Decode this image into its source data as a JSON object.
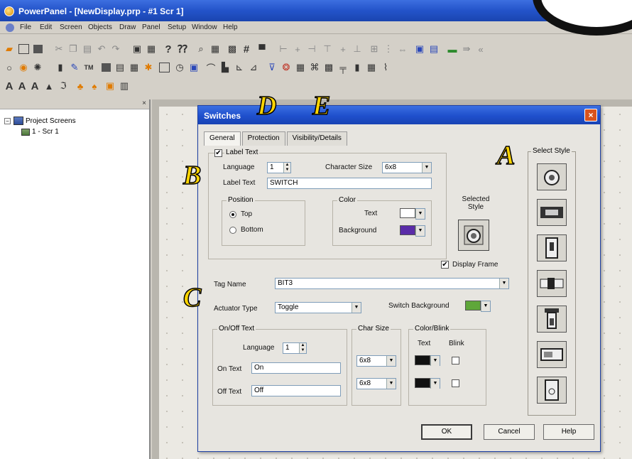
{
  "window": {
    "title": "PowerPanel - [NewDisplay.prp - #1 Scr 1]",
    "menu": [
      "File",
      "Edit",
      "Screen",
      "Objects",
      "Draw",
      "Panel",
      "Setup",
      "Window",
      "Help"
    ]
  },
  "toolbars": {
    "row1": [
      "open-icon",
      "new-icon",
      "save-icon",
      "cut-icon",
      "copy-icon",
      "paste-icon",
      "undo-icon",
      "redo-icon",
      "preview-icon",
      "print-icon",
      "help-icon",
      "context-help-icon",
      "zoom-icon",
      "grid-icon",
      "align-grid-icon",
      "hash-grid-icon",
      "snap-icon",
      "align-left-icon",
      "align-center-icon",
      "align-right-icon",
      "align-top-icon",
      "align-middle-icon",
      "align-bottom-icon",
      "distribute-h-icon",
      "distribute-v-icon",
      "size-icon",
      "color-icon",
      "layer-icon",
      "tag-icon",
      "more-icon",
      "scroll-icon"
    ],
    "row2": [
      "circle-icon",
      "filled-circle-icon",
      "star-icon",
      "meter-icon",
      "pen-icon",
      "tm-icon",
      "screen-icon",
      "list-icon",
      "table-icon",
      "lamp-icon",
      "box-icon",
      "clock-icon",
      "monitor-icon",
      "trend-icon",
      "bar-chart-icon",
      "gauge-icon",
      "alarm-icon",
      "recipe-icon",
      "sequence-icon",
      "node-icon",
      "pen-edit-icon",
      "keypad-icon",
      "message-icon",
      "data-icon",
      "exponent-icon",
      "pulse-icon"
    ],
    "row3": [
      "text-a-icon",
      "text-a2-icon",
      "text-a3-icon",
      "triangle-icon",
      "script-icon",
      "user-icon",
      "shapes-icon",
      "image-icon",
      "layout-icon"
    ]
  },
  "left_panel": {
    "close": "×",
    "tree": [
      {
        "label": "Project Screens",
        "expander": "−"
      },
      {
        "label": "1 - Scr 1"
      }
    ]
  },
  "dialog": {
    "title": "Switches",
    "close": "×",
    "tabs": [
      "General",
      "Protection",
      "Visibility/Details"
    ],
    "label_text": {
      "checkbox_label": "Label Text",
      "checked": true,
      "language_label": "Language",
      "language_value": "1",
      "char_size_label": "Character Size",
      "char_size_value": "6x8",
      "label_text_label": "Label Text",
      "label_text_value": "SWITCH",
      "position_label": "Position",
      "position_top": "Top",
      "position_bottom": "Bottom",
      "position_selected": "Top",
      "color_label": "Color",
      "text_color_label": "Text",
      "text_color": "#ffffff",
      "background_label": "Background",
      "background_color": "#5a2ca8"
    },
    "selected_style_label": "Selected Style",
    "display_frame_label": "Display Frame",
    "display_frame_checked": true,
    "tag_name_label": "Tag Name",
    "tag_name_value": "BIT3",
    "actuator_type_label": "Actuator Type",
    "actuator_type_value": "Toggle",
    "switch_background_label": "Switch Background",
    "switch_background_color": "#5fa73a",
    "onoff": {
      "group_label": "On/Off Text",
      "language_label": "Language",
      "language_value": "1",
      "on_text_label": "On Text",
      "on_text_value": "On",
      "off_text_label": "Off Text",
      "off_text_value": "Off"
    },
    "char_size": {
      "group_label": "Char Size",
      "on_value": "6x8",
      "off_value": "6x8"
    },
    "color_blink": {
      "group_label": "Color/Blink",
      "text_label": "Text",
      "blink_label": "Blink",
      "on_color": "#111111",
      "off_color": "#111111"
    },
    "select_style_label": "Select Style",
    "style_icons": [
      "rotary-switch-icon",
      "flat-panel-switch-icon",
      "toggle-switch-icon",
      "slide-switch-icon",
      "plunger-switch-icon",
      "rocker-switch-icon",
      "key-switch-icon"
    ],
    "buttons": {
      "ok": "OK",
      "cancel": "Cancel",
      "help": "Help"
    }
  },
  "overlay_letters": {
    "a": "A",
    "b": "B",
    "c": "C",
    "d": "D",
    "e": "E"
  }
}
